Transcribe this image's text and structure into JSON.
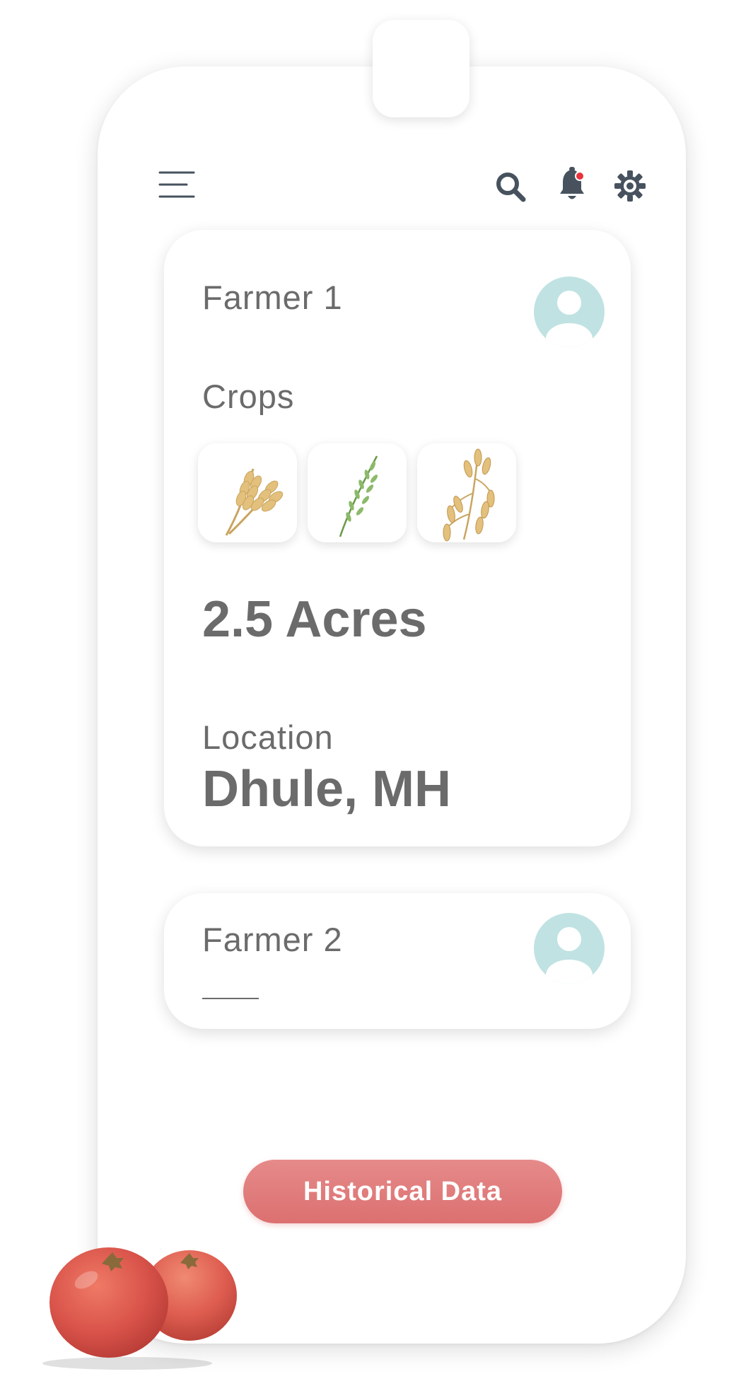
{
  "header": {
    "menu_icon": "hamburger-menu-icon",
    "search_icon": "search-icon",
    "notification_icon": "bell-icon",
    "settings_icon": "gear-icon",
    "notification_dot_color": "#e8323c",
    "icon_color": "#47525e"
  },
  "farmers": [
    {
      "name": "Farmer 1",
      "crops_label": "Crops",
      "crops": [
        "wheat-icon",
        "rice-icon",
        "oat-icon"
      ],
      "area": "2.5 Acres",
      "location_label": "Location",
      "location": "Dhule, MH"
    },
    {
      "name": "Farmer 2"
    }
  ],
  "actions": {
    "historical_label": "Historical Data",
    "button_color": "#e07777"
  },
  "colors": {
    "text": "#6b6b6b",
    "avatar": "#c0e2e2"
  }
}
